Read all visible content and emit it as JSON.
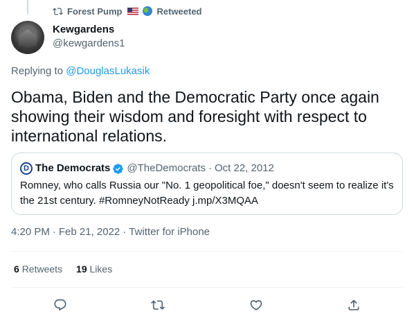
{
  "retweet_context": {
    "name": "Forest Pump",
    "action": "Retweeted"
  },
  "author": {
    "display_name": "Kewgardens",
    "handle": "@kewgardens1"
  },
  "replying": {
    "prefix": "Replying to",
    "target": "@DouglasLukasik"
  },
  "tweet": {
    "text": "Obama, Biden and the Democratic Party once again showing their wisdom and foresight with respect to international relations."
  },
  "quote": {
    "logo_letter": "D",
    "name": "The Democrats",
    "handle": "@TheDemocrats",
    "separator": "·",
    "date": "Oct 22, 2012",
    "text": "Romney, who calls Russia our \"No. 1 geopolitical foe,\" doesn't seem to realize it's the 21st century. #RomneyNotReady j.mp/X3MQAA"
  },
  "meta": {
    "time": "4:20 PM",
    "sep1": "·",
    "date": "Feb 21, 2022",
    "sep2": "·",
    "source": "Twitter for iPhone"
  },
  "stats": {
    "retweets_count": "6",
    "retweets_label": "Retweets",
    "likes_count": "19",
    "likes_label": "Likes"
  },
  "actions": [
    {
      "icon": "reply-icon"
    },
    {
      "icon": "retweet-icon"
    },
    {
      "icon": "like-icon"
    },
    {
      "icon": "share-icon"
    }
  ],
  "colors": {
    "accent": "#1d9bf0",
    "text": "#0f1419",
    "secondary": "#536471",
    "border": "#cfd9de"
  }
}
